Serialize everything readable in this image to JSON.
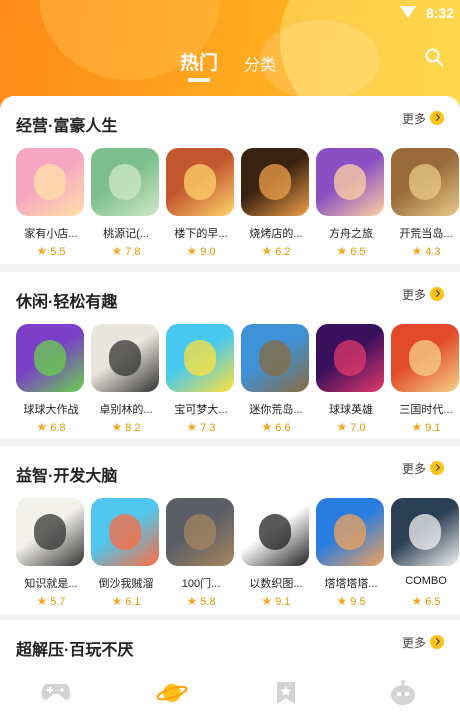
{
  "status": {
    "time": "8:32"
  },
  "tabs": {
    "hot": "热门",
    "category": "分类"
  },
  "sections": [
    {
      "title": "经营·富豪人生",
      "more": "更多",
      "games": [
        {
          "name": "家有小店...",
          "rating": "5.5",
          "colors": [
            "#f6a6c0",
            "#ffe0a8"
          ]
        },
        {
          "name": "桃源记(...",
          "rating": "7.8",
          "colors": [
            "#7dbf8c",
            "#cfe8c4"
          ]
        },
        {
          "name": "楼下的早...",
          "rating": "9.0",
          "colors": [
            "#c2572f",
            "#ffd36b"
          ]
        },
        {
          "name": "烧烤店的...",
          "rating": "6.2",
          "colors": [
            "#3a2210",
            "#f0a04a"
          ]
        },
        {
          "name": "方舟之旅",
          "rating": "6.5",
          "colors": [
            "#8a4fc2",
            "#ffd2a0"
          ]
        },
        {
          "name": "开荒当岛...",
          "rating": "4.3",
          "colors": [
            "#9a6b3a",
            "#e8c98a"
          ]
        }
      ]
    },
    {
      "title": "休闲·轻松有趣",
      "more": "更多",
      "games": [
        {
          "name": "球球大作战",
          "rating": "6.8",
          "colors": [
            "#7b3fc8",
            "#68d14b"
          ]
        },
        {
          "name": "卓别林的...",
          "rating": "8.2",
          "colors": [
            "#e9e6de",
            "#333333"
          ]
        },
        {
          "name": "宝可梦大...",
          "rating": "7.3",
          "colors": [
            "#46c8f0",
            "#ffe13a"
          ]
        },
        {
          "name": "迷你荒岛...",
          "rating": "6.6",
          "colors": [
            "#3e93d8",
            "#8a6a3e"
          ]
        },
        {
          "name": "球球英雄",
          "rating": "7.0",
          "colors": [
            "#3a0f5c",
            "#e23a6b"
          ]
        },
        {
          "name": "三国时代...",
          "rating": "9.1",
          "colors": [
            "#e24a2a",
            "#f5d28a"
          ]
        }
      ]
    },
    {
      "title": "益智·开发大脑",
      "more": "更多",
      "games": [
        {
          "name": "知识就是...",
          "rating": "5.7",
          "colors": [
            "#f3f1ec",
            "#333333"
          ]
        },
        {
          "name": "倒沙我贼溜",
          "rating": "6.1",
          "colors": [
            "#4fc7ef",
            "#ff6a3d"
          ]
        },
        {
          "name": "100门...",
          "rating": "5.8",
          "colors": [
            "#5b5e66",
            "#a68660"
          ]
        },
        {
          "name": "以数织图...",
          "rating": "9.1",
          "colors": [
            "#ffffff",
            "#222222"
          ]
        },
        {
          "name": "塔塔塔塔...",
          "rating": "9.5",
          "colors": [
            "#2a7de0",
            "#f2a35a"
          ]
        },
        {
          "name": "COMBO",
          "rating": "6.5",
          "colors": [
            "#2b3f55",
            "#f2f2f2"
          ]
        }
      ]
    },
    {
      "title": "超解压·百玩不厌",
      "more": "更多"
    }
  ],
  "icons": {
    "search": "search-icon",
    "nav": [
      "gamepad-icon",
      "planet-icon",
      "bookmark-star-icon",
      "robot-icon"
    ]
  },
  "theme": {
    "accent": "#ffc21a",
    "header_start": "#ff8a1a",
    "header_end": "#ffc92a",
    "nav_active": "#ffc21a",
    "nav_inactive": "#d4d4d4"
  }
}
